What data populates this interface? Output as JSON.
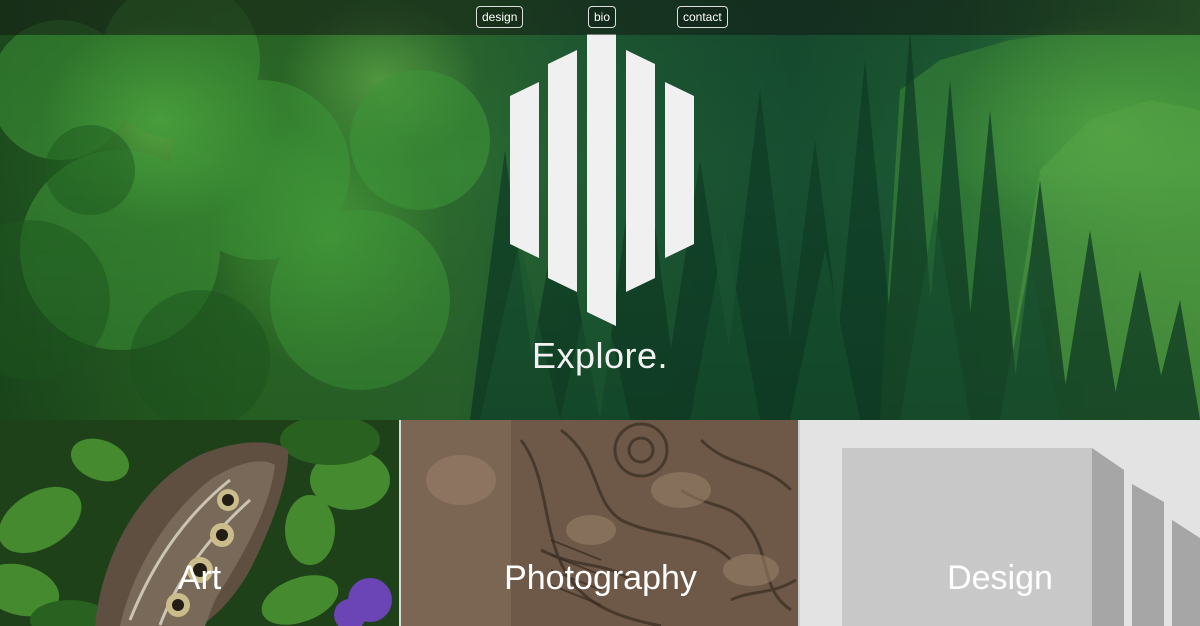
{
  "nav": {
    "items": [
      {
        "label": "design"
      },
      {
        "label": "bio"
      },
      {
        "label": "contact"
      }
    ]
  },
  "hero": {
    "title": "Explore."
  },
  "tiles": [
    {
      "label": "Art"
    },
    {
      "label": "Photography"
    },
    {
      "label": "Design"
    }
  ],
  "colors": {
    "nav_bar": "#1a1f1a",
    "logo": "#f0f0f0",
    "text": "#ffffff",
    "design_tile": "#e2e2e2"
  }
}
